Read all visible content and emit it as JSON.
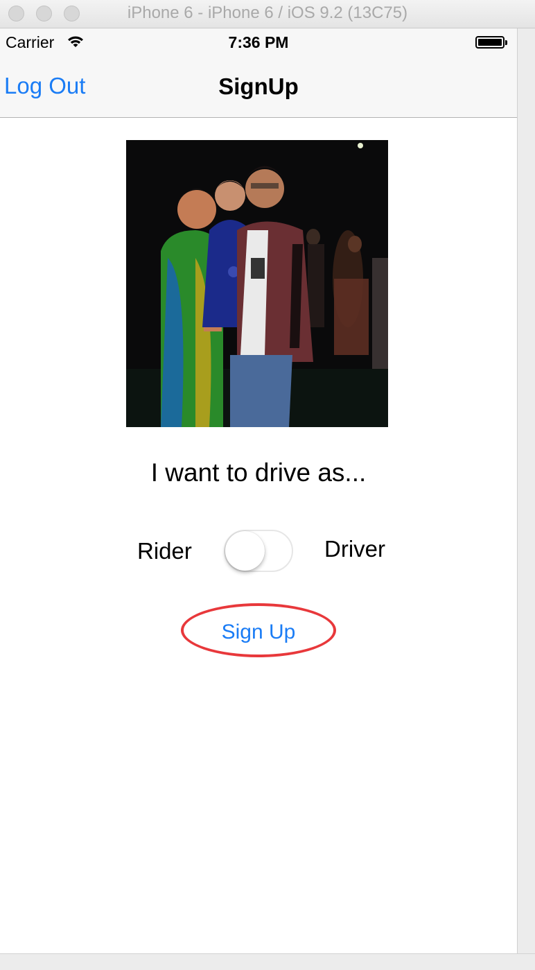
{
  "window": {
    "title": "iPhone 6 - iPhone 6 / iOS 9.2 (13C75)"
  },
  "status_bar": {
    "carrier": "Carrier",
    "time": "7:36 PM",
    "signal_icon": "wifi-icon",
    "battery_icon": "battery-icon"
  },
  "nav_bar": {
    "left_button": "Log Out",
    "title": "SignUp"
  },
  "content": {
    "photo_alt": "profile photo",
    "prompt": "I want to drive as...",
    "switch": {
      "left_label": "Rider",
      "right_label": "Driver",
      "is_on": false
    },
    "signup_button": "Sign Up"
  },
  "colors": {
    "ios_blue": "#1a7cf5",
    "annotation_red": "#e8383b"
  }
}
